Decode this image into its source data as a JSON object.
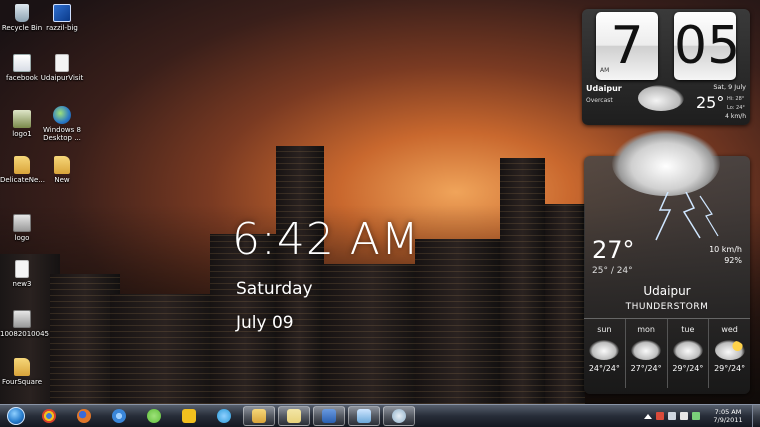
{
  "desktop_icons": [
    {
      "label": "Recycle Bin",
      "icon": "recycle-bin-icon"
    },
    {
      "label": "razzil-big",
      "icon": "app-icon"
    },
    {
      "label": "facebook",
      "icon": "text-file-icon"
    },
    {
      "label": "UdaipurVisit",
      "icon": "document-icon"
    },
    {
      "label": "logo1",
      "icon": "image-icon"
    },
    {
      "label": "Windows 8 Desktop ...",
      "icon": "web-shortcut-icon"
    },
    {
      "label": "DelicateNe...",
      "icon": "folder-icon"
    },
    {
      "label": "New",
      "icon": "folder-icon"
    },
    {
      "label": "logo",
      "icon": "image-icon"
    },
    {
      "label": "new3",
      "icon": "document-icon"
    },
    {
      "label": "10082010045",
      "icon": "image-icon"
    },
    {
      "label": "FourSquare",
      "icon": "folder-icon"
    }
  ],
  "big_clock": {
    "time": "6:42 AM",
    "day": "Saturday",
    "date": "July 09"
  },
  "htc_clock": {
    "hour": "7",
    "minute": "05",
    "ampm": "AM",
    "city": "Udaipur",
    "condition": "Overcast",
    "date": "Sat, 9 July",
    "temp": "25°",
    "hi": "Hi: 28°",
    "lo": "Lo: 24°",
    "wind": "4 km/h"
  },
  "weather": {
    "temp": "27°",
    "range": "25° / 24°",
    "wind": "10 km/h",
    "humidity": "92%",
    "city": "Udaipur",
    "condition": "THUNDERSTORM",
    "forecast": [
      {
        "day": "sun",
        "temps": "24°/24°"
      },
      {
        "day": "mon",
        "temps": "27°/24°"
      },
      {
        "day": "tue",
        "temps": "29°/24°"
      },
      {
        "day": "wed",
        "temps": "29°/24°"
      }
    ]
  },
  "taskbar": {
    "items": [
      {
        "name": "chrome",
        "color": "#d9402a"
      },
      {
        "name": "firefox",
        "color": "#e0762a"
      },
      {
        "name": "internet-explorer",
        "color": "#3a86d9"
      },
      {
        "name": "messenger",
        "color": "#5fbf3a"
      },
      {
        "name": "sticky-app",
        "color": "#f2c01e"
      },
      {
        "name": "tweetdeck",
        "color": "#2a9ad9"
      },
      {
        "name": "windows-explorer",
        "color": "#f1c760"
      },
      {
        "name": "file-folder",
        "color": "#e8d27a"
      },
      {
        "name": "word-document",
        "color": "#2a5fb0"
      },
      {
        "name": "browser-window",
        "color": "#6aa8d9"
      },
      {
        "name": "media-app",
        "color": "#8fb0c9"
      }
    ],
    "clock_time": "7:05 AM",
    "clock_date": "7/9/2011"
  }
}
